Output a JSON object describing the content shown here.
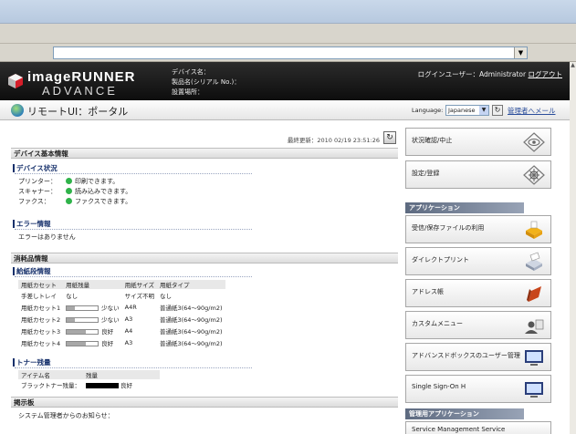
{
  "header": {
    "brand_line1": "imageRUNNER",
    "brand_line2": "ADVANCE",
    "device_name_label": "デバイス名：",
    "product_name_label": "製品名(シリアル No.)：",
    "location_label": "設置場所：",
    "login_user_text": "ログインユーザー：Administrator",
    "logout_label": "ログアウト"
  },
  "subheader": {
    "title": "リモートUI：ポータル",
    "language_label": "Language:",
    "language_value": "Japanese",
    "admin_mail_label": "管理者へメール"
  },
  "main": {
    "last_updated": "最終更新：2010 02/19 23:51:26",
    "device_info_title": "デバイス基本情報",
    "device_status": {
      "heading": "デバイス状況",
      "items": [
        {
          "label": "プリンター：",
          "status": "印刷できます。"
        },
        {
          "label": "スキャナー：",
          "status": "読み込みできます。"
        },
        {
          "label": "ファクス：",
          "status": "ファクスできます。"
        }
      ]
    },
    "error_info": {
      "heading": "エラー情報",
      "message": "エラーはありません"
    },
    "consumables_title": "消耗品情報",
    "paper_info": {
      "heading": "給紙段情報",
      "columns": [
        "用紙カセット",
        "用紙残量",
        "用紙サイズ",
        "用紙タイプ"
      ],
      "rows": [
        {
          "source": "手差しトレイ",
          "level_text": "なし",
          "level": null,
          "size": "サイズ不明",
          "type": "なし"
        },
        {
          "source": "用紙カセット1",
          "level_text": "少ない",
          "level": 0.25,
          "size": "A4R",
          "type": "普通紙3(64～90g/m2)"
        },
        {
          "source": "用紙カセット2",
          "level_text": "少ない",
          "level": 0.25,
          "size": "A3",
          "type": "普通紙3(64～90g/m2)"
        },
        {
          "source": "用紙カセット3",
          "level_text": "良好",
          "level": 0.6,
          "size": "A4",
          "type": "普通紙3(64～90g/m2)"
        },
        {
          "source": "用紙カセット4",
          "level_text": "良好",
          "level": 0.6,
          "size": "A3",
          "type": "普通紙3(64～90g/m2)"
        }
      ]
    },
    "toner_info": {
      "heading": "トナー残量",
      "columns": [
        "アイテム名",
        "残量"
      ],
      "rows": [
        {
          "name": "ブラックトナー残量：",
          "level": 1.0,
          "level_text": "良好"
        }
      ]
    },
    "bulletin": {
      "title": "掲示板",
      "message": "システム管理者からのお知らせ："
    }
  },
  "side": {
    "top_buttons": [
      {
        "label": "状況確認/中止",
        "icon": "status-eye-icon"
      },
      {
        "label": "設定/登録",
        "icon": "settings-gear-icon"
      }
    ],
    "apps_header": "アプリケーション",
    "app_buttons": [
      {
        "label": "受信/保存ファイルの利用",
        "icon": "stored-files-icon"
      },
      {
        "label": "ダイレクトプリント",
        "icon": "direct-print-icon"
      },
      {
        "label": "アドレス帳",
        "icon": "address-book-icon"
      },
      {
        "label": "カスタムメニュー",
        "icon": "custom-menu-icon"
      },
      {
        "label": "アドバンスドボックスのユーザー管理",
        "icon": "advanced-box-monitor-icon"
      },
      {
        "label": "Single Sign-On H",
        "icon": "sso-monitor-icon"
      }
    ],
    "mgmt_header": "管理用アプリケーション",
    "mgmt_partial": "Service Management Service"
  }
}
